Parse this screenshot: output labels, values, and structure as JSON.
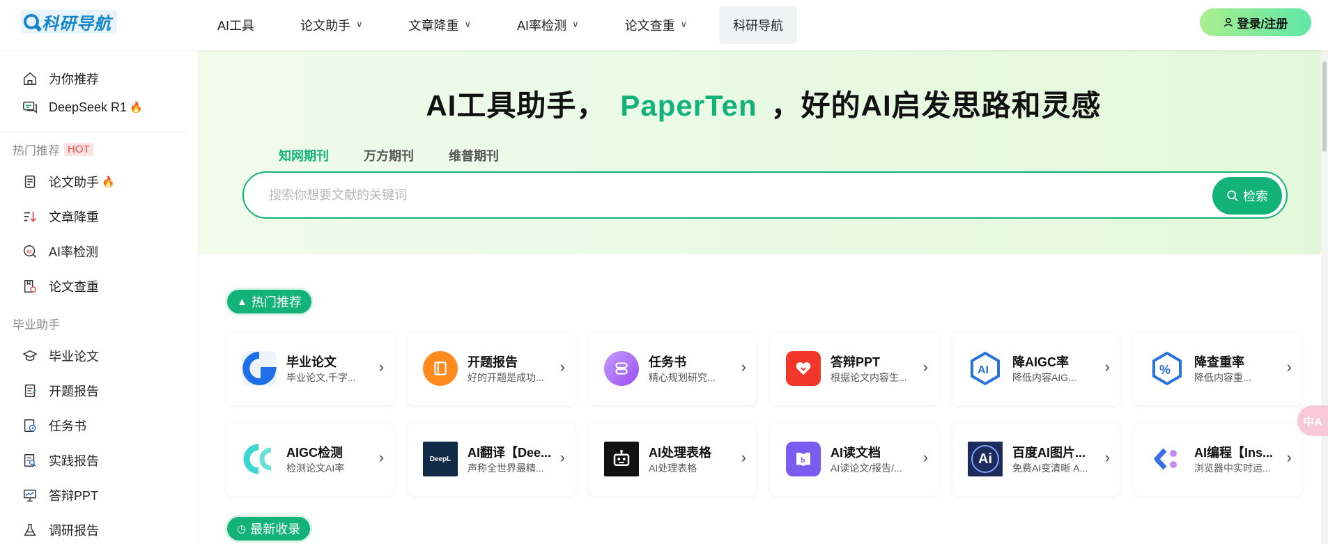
{
  "header": {
    "logo_text": "科研导航",
    "nav": [
      {
        "label": "AI工具",
        "dropdown": false
      },
      {
        "label": "论文助手",
        "dropdown": true
      },
      {
        "label": "文章降重",
        "dropdown": true
      },
      {
        "label": "AI率检测",
        "dropdown": true
      },
      {
        "label": "论文查重",
        "dropdown": true
      },
      {
        "label": "科研导航",
        "dropdown": false,
        "active": true
      }
    ],
    "login_label": "登录/注册"
  },
  "sidebar": {
    "top_items": [
      {
        "label": "为你推荐",
        "icon": "home-icon"
      },
      {
        "label": "DeepSeek R1",
        "icon": "chat-icon",
        "hot": true
      }
    ],
    "group_hot": {
      "label": "热门推荐",
      "badge": "HOT"
    },
    "hot_items": [
      {
        "label": "论文助手",
        "icon": "document-icon",
        "hot": true
      },
      {
        "label": "文章降重",
        "icon": "sort-down-icon"
      },
      {
        "label": "AI率检测",
        "icon": "ai-detect-icon"
      },
      {
        "label": "论文查重",
        "icon": "book-check-icon"
      }
    ],
    "group_grad": {
      "label": "毕业助手"
    },
    "grad_items": [
      {
        "label": "毕业论文",
        "icon": "graduation-cap-icon"
      },
      {
        "label": "开题报告",
        "icon": "report-icon"
      },
      {
        "label": "任务书",
        "icon": "task-icon"
      },
      {
        "label": "实践报告",
        "icon": "practice-icon"
      },
      {
        "label": "答辩PPT",
        "icon": "presentation-icon"
      },
      {
        "label": "调研报告",
        "icon": "flask-icon"
      }
    ]
  },
  "hero": {
    "title_prefix": "AI工具助手，",
    "title_brand": "PaperTen",
    "title_suffix": "，好的AI启发思路和灵感",
    "tabs": [
      "知网期刊",
      "万方期刊",
      "维普期刊"
    ],
    "active_tab": 0,
    "search_placeholder": "搜索你想要文献的关键词",
    "search_button": "检索"
  },
  "sections": {
    "hot_label": "热门推荐",
    "new_label": "最新收录"
  },
  "cards_row1": [
    {
      "title": "毕业论文",
      "desc": "毕业论文,千字...",
      "color": "#1f6fe8",
      "icon": "paperten-icon"
    },
    {
      "title": "开题报告",
      "desc": "好的开题是成功...",
      "color": "#ff8a1f",
      "icon": "notebook-icon"
    },
    {
      "title": "任务书",
      "desc": "精心规划研究...",
      "color": "#b165f5",
      "icon": "list-icon"
    },
    {
      "title": "答辩PPT",
      "desc": "根据论文内容生...",
      "color": "#f1362a",
      "icon": "heart-icon"
    },
    {
      "title": "降AIGC率",
      "desc": "降低内容AIG...",
      "color": "#2a73d9",
      "icon": "ai-badge-icon"
    },
    {
      "title": "降查重率",
      "desc": "降低内容重...",
      "color": "#2a73d9",
      "icon": "percent-badge-icon"
    }
  ],
  "cards_row2": [
    {
      "title": "AIGC检测",
      "desc": "检测论文AI率",
      "color": "#3ad7d3",
      "icon": "aigc-icon"
    },
    {
      "title": "AI翻译【Dee...",
      "desc": "声称全世界最精...",
      "color": "#0f2b46",
      "icon": "deepl-icon",
      "logo_text": "DeepL"
    },
    {
      "title": "AI处理表格",
      "desc": "AI处理表格",
      "color": "#111111",
      "icon": "robot-icon"
    },
    {
      "title": "AI读文档",
      "desc": "AI读论文/报告/...",
      "color": "#7b5cf0",
      "icon": "doc-reader-icon"
    },
    {
      "title": "百度AI图片...",
      "desc": "免费AI变清晰 A...",
      "color": "#1c2a5c",
      "icon": "baidu-ai-icon",
      "logo_text": "Ai"
    },
    {
      "title": "AI编程【Ins...",
      "desc": "浏览器中实时运...",
      "color": "#ffffff",
      "icon": "code-icon"
    }
  ],
  "translate_fab": "中A"
}
